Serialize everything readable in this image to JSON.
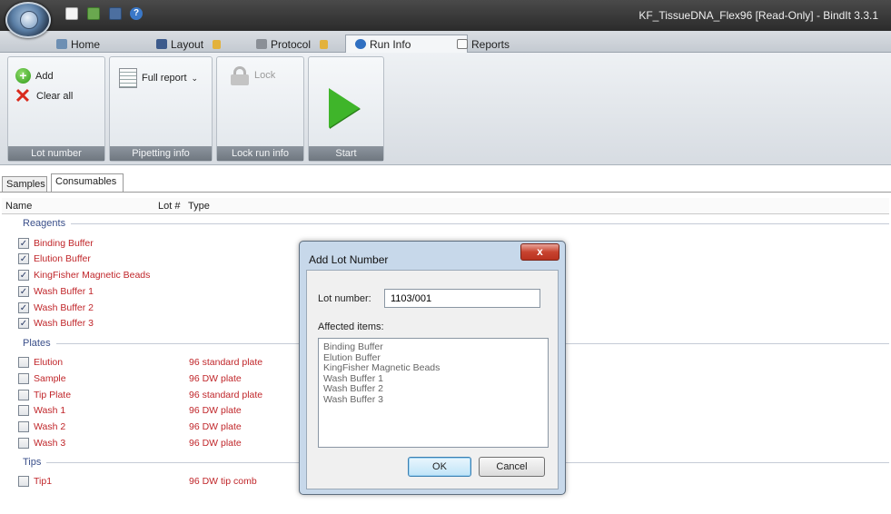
{
  "window": {
    "title": "KF_TissueDNA_Flex96 [Read-Only] - BindIt 3.3.1",
    "quick_access_icons": [
      "new-file-icon",
      "open-folder-icon",
      "save-icon",
      "help-icon"
    ]
  },
  "ribbon_tabs": [
    {
      "label": "Home",
      "icon": "home-icon",
      "locked": false
    },
    {
      "label": "Layout",
      "icon": "layout-icon",
      "locked": true
    },
    {
      "label": "Protocol",
      "icon": "protocol-icon",
      "locked": true
    },
    {
      "label": "Run Info",
      "icon": "info-icon",
      "locked": false,
      "active": true
    },
    {
      "label": "Reports",
      "icon": "reports-icon",
      "locked": false
    }
  ],
  "ribbon": {
    "lot_number_group": {
      "label": "Lot number",
      "add": "Add",
      "clear_all": "Clear all"
    },
    "pipetting_group": {
      "label": "Pipetting info",
      "report_select": "Full report"
    },
    "lock_group": {
      "label": "Lock run info",
      "lock": "Lock"
    },
    "start_group": {
      "label": "Start"
    }
  },
  "subtabs": [
    {
      "label": "Samples",
      "active": false
    },
    {
      "label": "Consumables",
      "active": true
    }
  ],
  "grid": {
    "columns": {
      "name": "Name",
      "lot": "Lot #",
      "type": "Type"
    },
    "sections": [
      {
        "title": "Reagents",
        "items": [
          {
            "name": "Binding Buffer",
            "type": "",
            "checked": true
          },
          {
            "name": "Elution Buffer",
            "type": "",
            "checked": true
          },
          {
            "name": "KingFisher Magnetic Beads",
            "type": "",
            "checked": true
          },
          {
            "name": "Wash Buffer 1",
            "type": "",
            "checked": true
          },
          {
            "name": "Wash Buffer 2",
            "type": "",
            "checked": true
          },
          {
            "name": "Wash Buffer 3",
            "type": "",
            "checked": true
          }
        ]
      },
      {
        "title": "Plates",
        "items": [
          {
            "name": "Elution",
            "type": "96 standard plate",
            "checked": false
          },
          {
            "name": "Sample",
            "type": "96 DW plate",
            "checked": false
          },
          {
            "name": "Tip Plate",
            "type": "96 standard plate",
            "checked": false
          },
          {
            "name": "Wash 1",
            "type": "96 DW plate",
            "checked": false
          },
          {
            "name": "Wash 2",
            "type": "96 DW plate",
            "checked": false
          },
          {
            "name": "Wash 3",
            "type": "96 DW plate",
            "checked": false
          }
        ]
      },
      {
        "title": "Tips",
        "items": [
          {
            "name": "Tip1",
            "type": "96 DW tip comb",
            "checked": false
          }
        ]
      }
    ]
  },
  "dialog": {
    "title": "Add Lot Number",
    "close": "x",
    "lot_label": "Lot number:",
    "lot_value": "1103/001",
    "affected_label": "Affected items:",
    "affected_items": [
      "Binding Buffer",
      "Elution Buffer",
      "KingFisher Magnetic Beads",
      "Wash Buffer 1",
      "Wash Buffer 2",
      "Wash Buffer 3"
    ],
    "ok": "OK",
    "cancel": "Cancel"
  },
  "colors": {
    "item_text": "#c0262a",
    "section_title": "#3a4f8a",
    "start_green": "#3fb52a",
    "close_red": "#c8432f"
  }
}
